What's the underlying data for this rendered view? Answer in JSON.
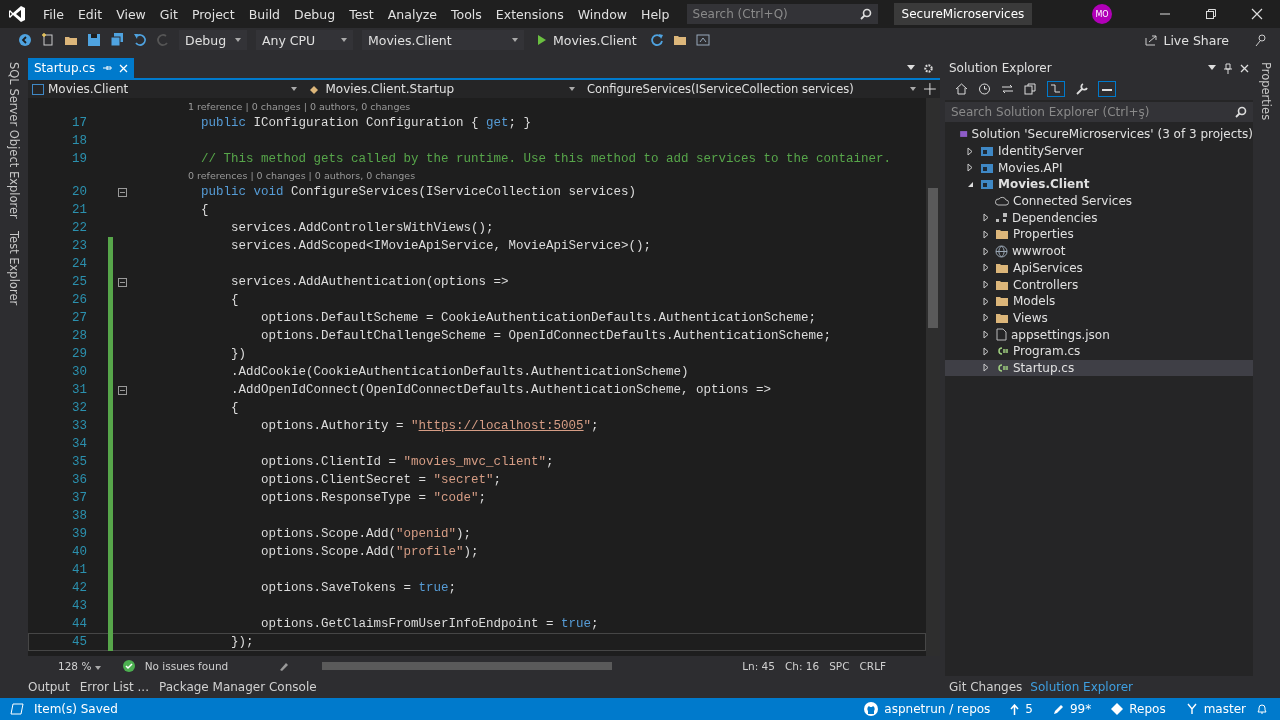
{
  "title_bar": {
    "menu": [
      "File",
      "Edit",
      "View",
      "Git",
      "Project",
      "Build",
      "Debug",
      "Test",
      "Analyze",
      "Tools",
      "Extensions",
      "Window",
      "Help"
    ],
    "search": {
      "placeholder": "Search (Ctrl+Q)"
    },
    "solution_name": "SecureMicroservices",
    "avatar": "MO"
  },
  "toolbar": {
    "configuration": "Debug",
    "platform": "Any CPU",
    "startup_project": "Movies.Client",
    "run_label": "Movies.Client",
    "live_share": "Live Share"
  },
  "side_left": [
    "SQL Server Object Explorer",
    "Test Explorer"
  ],
  "side_right": [
    "Properties"
  ],
  "doc_tabs": [
    {
      "label": "Startup.cs",
      "selected": true
    }
  ],
  "nav_bar": {
    "project": "Movies.Client",
    "type": "Movies.Client.Startup",
    "member": "ConfigureServices(IServiceCollection services)"
  },
  "code": [
    {
      "kind": "lens",
      "text": "1 reference | 0 changes | 0 authors, 0 changes"
    },
    {
      "kind": "code",
      "number": "17",
      "changed": false,
      "tokens": [
        {
          "kind": "keyword",
          "text": "        public"
        },
        {
          "kind": "plain",
          "text": " IConfiguration Configuration { "
        },
        {
          "kind": "keyword",
          "text": "get"
        },
        {
          "kind": "plain",
          "text": "; }"
        }
      ]
    },
    {
      "kind": "code",
      "number": "18",
      "changed": false
    },
    {
      "kind": "code",
      "number": "19",
      "changed": false,
      "tokens": [
        {
          "kind": "comment",
          "text": "        // This method gets called by the runtime. Use this method to add services to the container."
        }
      ]
    },
    {
      "kind": "lens",
      "text": "0 references | 0 changes | 0 authors, 0 changes"
    },
    {
      "kind": "code",
      "number": "20",
      "changed": false,
      "fold": true,
      "tokens": [
        {
          "kind": "keyword",
          "text": "        public void"
        },
        {
          "kind": "plain",
          "text": " ConfigureServices(IServiceCollection services)"
        }
      ]
    },
    {
      "kind": "code",
      "number": "21",
      "changed": false,
      "tokens": [
        {
          "kind": "plain",
          "text": "        {"
        }
      ]
    },
    {
      "kind": "code",
      "number": "22",
      "changed": false,
      "tokens": [
        {
          "kind": "plain",
          "text": "            services.AddControllersWithViews();"
        }
      ]
    },
    {
      "kind": "code",
      "number": "23",
      "changed": true,
      "tokens": [
        {
          "kind": "plain",
          "text": "            services.AddScoped<IMovieApiService, MovieApiService>();"
        }
      ]
    },
    {
      "kind": "code",
      "number": "24",
      "changed": true
    },
    {
      "kind": "code",
      "number": "25",
      "changed": true,
      "fold": true,
      "tokens": [
        {
          "kind": "plain",
          "text": "            services.AddAuthentication(options =>"
        }
      ]
    },
    {
      "kind": "code",
      "number": "26",
      "changed": true,
      "tokens": [
        {
          "kind": "plain",
          "text": "            {"
        }
      ]
    },
    {
      "kind": "code",
      "number": "27",
      "changed": true,
      "tokens": [
        {
          "kind": "plain",
          "text": "                options.DefaultScheme = CookieAuthenticationDefaults.AuthenticationScheme;"
        }
      ]
    },
    {
      "kind": "code",
      "number": "28",
      "changed": true,
      "tokens": [
        {
          "kind": "plain",
          "text": "                options.DefaultChallengeScheme = OpenIdConnectDefaults.AuthenticationScheme;"
        }
      ]
    },
    {
      "kind": "code",
      "number": "29",
      "changed": true,
      "tokens": [
        {
          "kind": "plain",
          "text": "            })"
        }
      ]
    },
    {
      "kind": "code",
      "number": "30",
      "changed": true,
      "tokens": [
        {
          "kind": "plain",
          "text": "            .AddCookie(CookieAuthenticationDefaults.AuthenticationScheme)"
        }
      ]
    },
    {
      "kind": "code",
      "number": "31",
      "changed": true,
      "fold": true,
      "tokens": [
        {
          "kind": "plain",
          "text": "            .AddOpenIdConnect(OpenIdConnectDefaults.AuthenticationScheme, options =>"
        }
      ]
    },
    {
      "kind": "code",
      "number": "32",
      "changed": true,
      "tokens": [
        {
          "kind": "plain",
          "text": "            {"
        }
      ]
    },
    {
      "kind": "code",
      "number": "33",
      "changed": true,
      "tokens": [
        {
          "kind": "plain",
          "text": "                options.Authority = "
        },
        {
          "kind": "string",
          "text": "\""
        },
        {
          "kind": "link",
          "text": "https://localhost:5005"
        },
        {
          "kind": "string",
          "text": "\""
        },
        {
          "kind": "plain",
          "text": ";"
        }
      ]
    },
    {
      "kind": "code",
      "number": "34",
      "changed": true
    },
    {
      "kind": "code",
      "number": "35",
      "changed": true,
      "tokens": [
        {
          "kind": "plain",
          "text": "                options.ClientId = "
        },
        {
          "kind": "string",
          "text": "\"movies_mvc_client\""
        },
        {
          "kind": "plain",
          "text": ";"
        }
      ]
    },
    {
      "kind": "code",
      "number": "36",
      "changed": true,
      "tokens": [
        {
          "kind": "plain",
          "text": "                options.ClientSecret = "
        },
        {
          "kind": "string",
          "text": "\"secret\""
        },
        {
          "kind": "plain",
          "text": ";"
        }
      ]
    },
    {
      "kind": "code",
      "number": "37",
      "changed": true,
      "tokens": [
        {
          "kind": "plain",
          "text": "                options.ResponseType = "
        },
        {
          "kind": "string",
          "text": "\"code\""
        },
        {
          "kind": "plain",
          "text": ";"
        }
      ]
    },
    {
      "kind": "code",
      "number": "38",
      "changed": true
    },
    {
      "kind": "code",
      "number": "39",
      "changed": true,
      "tokens": [
        {
          "kind": "plain",
          "text": "                options.Scope.Add("
        },
        {
          "kind": "string",
          "text": "\"openid\""
        },
        {
          "kind": "plain",
          "text": ");"
        }
      ]
    },
    {
      "kind": "code",
      "number": "40",
      "changed": true,
      "tokens": [
        {
          "kind": "plain",
          "text": "                options.Scope.Add("
        },
        {
          "kind": "string",
          "text": "\"profile\""
        },
        {
          "kind": "plain",
          "text": ");"
        }
      ]
    },
    {
      "kind": "code",
      "number": "41",
      "changed": true
    },
    {
      "kind": "code",
      "number": "42",
      "changed": true,
      "tokens": [
        {
          "kind": "plain",
          "text": "                options.SaveTokens = "
        },
        {
          "kind": "keyword",
          "text": "true"
        },
        {
          "kind": "plain",
          "text": ";"
        }
      ]
    },
    {
      "kind": "code",
      "number": "43",
      "changed": true
    },
    {
      "kind": "code",
      "number": "44",
      "changed": true,
      "tokens": [
        {
          "kind": "plain",
          "text": "                options.GetClaimsFromUserInfoEndpoint = "
        },
        {
          "kind": "keyword",
          "text": "true"
        },
        {
          "kind": "plain",
          "text": ";"
        }
      ]
    },
    {
      "kind": "code",
      "number": "45",
      "changed": true,
      "current": true,
      "tokens": [
        {
          "kind": "plain",
          "text": "            });"
        }
      ]
    }
  ],
  "editor_status": {
    "zoom": "128 %",
    "issues": "No issues found",
    "line": "Ln: 45",
    "column": "Ch: 16",
    "whitespace": "SPC",
    "line_ending": "CRLF"
  },
  "bottom_tabs": [
    "Output",
    "Error List ...",
    "Package Manager Console"
  ],
  "solution_explorer": {
    "title": "Solution Explorer",
    "search": {
      "placeholder": "Search Solution Explorer (Ctrl+ş)"
    },
    "tree": [
      {
        "kind": "solution",
        "label": "Solution 'SecureMicroservices' (3 of 3 projects)",
        "selected": false,
        "children": [
          {
            "kind": "project",
            "label": "IdentityServer",
            "expanded": false,
            "startup": false,
            "selected": false
          },
          {
            "kind": "project",
            "label": "Movies.API",
            "expanded": false,
            "startup": false,
            "selected": false
          },
          {
            "kind": "project",
            "label": "Movies.Client",
            "expanded": true,
            "startup": true,
            "selected": false,
            "children": [
              {
                "kind": "connected",
                "label": "Connected Services",
                "selected": false
              },
              {
                "kind": "dependencies",
                "label": "Dependencies",
                "expanded": false,
                "selected": false
              },
              {
                "kind": "properties",
                "label": "Properties",
                "expanded": false,
                "selected": false
              },
              {
                "kind": "web",
                "label": "wwwroot",
                "expanded": false,
                "selected": false
              },
              {
                "kind": "folder",
                "label": "ApiServices",
                "expanded": false,
                "selected": false
              },
              {
                "kind": "folder",
                "label": "Controllers",
                "expanded": false,
                "selected": false
              },
              {
                "kind": "folder",
                "label": "Models",
                "expanded": false,
                "selected": false
              },
              {
                "kind": "folder",
                "label": "Views",
                "expanded": false,
                "selected": false
              },
              {
                "kind": "json",
                "label": "appsettings.json",
                "expanded": false,
                "selected": false
              },
              {
                "kind": "csharp",
                "label": "Program.cs",
                "expanded": false,
                "selected": false
              },
              {
                "kind": "csharp",
                "label": "Startup.cs",
                "expanded": false,
                "selected": true
              }
            ]
          }
        ]
      }
    ],
    "tabs": [
      {
        "label": "Git Changes",
        "selected": false
      },
      {
        "label": "Solution Explorer",
        "selected": true
      }
    ]
  },
  "status_bar": {
    "message": "Item(s) Saved",
    "repo": "aspnetrun / repos",
    "outgoing": "5",
    "changes": "99*",
    "repos": "Repos",
    "branch": "master"
  }
}
